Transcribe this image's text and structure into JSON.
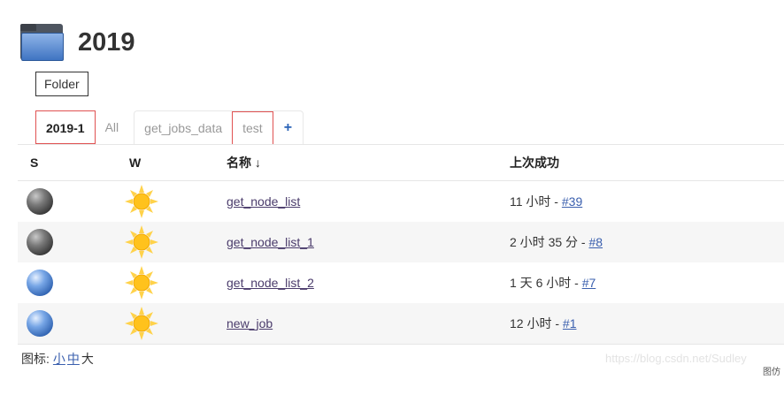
{
  "page": {
    "title": "2019",
    "description": "Folder"
  },
  "tabs": [
    {
      "label": "2019-1",
      "active": true
    },
    {
      "label": "All",
      "active": false
    },
    {
      "label": "get_jobs_data",
      "active": false
    },
    {
      "label": "test",
      "active": false
    },
    {
      "label": "+",
      "active": false
    }
  ],
  "table": {
    "headers": {
      "s": "S",
      "w": "W",
      "name": "名称 ↓",
      "last_success": "上次成功"
    },
    "rows": [
      {
        "status": "grey",
        "weather": "sunny",
        "name": "get_node_list",
        "last_success": "11 小时 - ",
        "build": "#39"
      },
      {
        "status": "grey",
        "weather": "sunny",
        "name": "get_node_list_1",
        "last_success": "2 小时 35 分 - ",
        "build": "#8"
      },
      {
        "status": "blue",
        "weather": "sunny",
        "name": "get_node_list_2",
        "last_success": "1 天 6 小时 - ",
        "build": "#7"
      },
      {
        "status": "blue",
        "weather": "sunny",
        "name": "new_job",
        "last_success": "12 小时 - ",
        "build": "#1"
      }
    ]
  },
  "footer": {
    "label": "图标:",
    "size_small": "小",
    "size_medium": "中",
    "size_large": "大"
  },
  "watermark": "https://blog.csdn.net/Sudley",
  "watermark_corner": "图仿"
}
